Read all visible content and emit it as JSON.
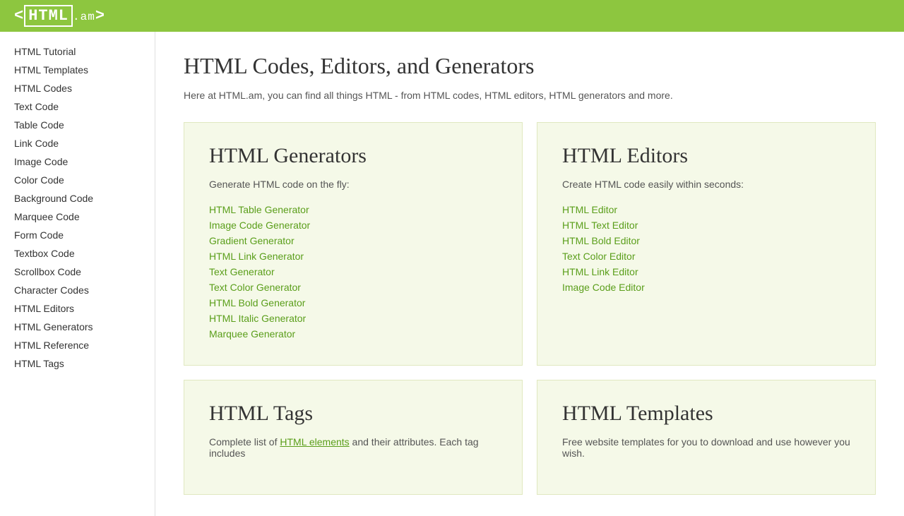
{
  "header": {
    "logo_text": "<HTML.am>"
  },
  "sidebar": {
    "items": [
      {
        "label": "HTML Tutorial",
        "id": "html-tutorial"
      },
      {
        "label": "HTML Templates",
        "id": "html-templates"
      },
      {
        "label": "HTML Codes",
        "id": "html-codes"
      },
      {
        "label": "Text Code",
        "id": "text-code"
      },
      {
        "label": "Table Code",
        "id": "table-code"
      },
      {
        "label": "Link Code",
        "id": "link-code"
      },
      {
        "label": "Image Code",
        "id": "image-code"
      },
      {
        "label": "Color Code",
        "id": "color-code"
      },
      {
        "label": "Background Code",
        "id": "background-code"
      },
      {
        "label": "Marquee Code",
        "id": "marquee-code"
      },
      {
        "label": "Form Code",
        "id": "form-code"
      },
      {
        "label": "Textbox Code",
        "id": "textbox-code"
      },
      {
        "label": "Scrollbox Code",
        "id": "scrollbox-code"
      },
      {
        "label": "Character Codes",
        "id": "character-codes"
      },
      {
        "label": "HTML Editors",
        "id": "html-editors"
      },
      {
        "label": "HTML Generators",
        "id": "html-generators"
      },
      {
        "label": "HTML Reference",
        "id": "html-reference"
      },
      {
        "label": "HTML Tags",
        "id": "html-tags"
      }
    ]
  },
  "main": {
    "page_title": "HTML Codes, Editors, and Generators",
    "page_description": "Here at HTML.am, you can find all things HTML - from HTML codes, HTML editors, HTML generators and more.",
    "sections": [
      {
        "id": "html-generators",
        "title": "HTML Generators",
        "description": "Generate HTML code on the fly:",
        "links": [
          {
            "label": "HTML Table Generator",
            "id": "html-table-generator"
          },
          {
            "label": "Image Code Generator",
            "id": "image-code-generator"
          },
          {
            "label": "Gradient Generator",
            "id": "gradient-generator"
          },
          {
            "label": "HTML Link Generator",
            "id": "html-link-generator"
          },
          {
            "label": "Text Generator",
            "id": "text-generator"
          },
          {
            "label": "Text Color Generator",
            "id": "text-color-generator"
          },
          {
            "label": "HTML Bold Generator",
            "id": "html-bold-generator"
          },
          {
            "label": "HTML Italic Generator",
            "id": "html-italic-generator"
          },
          {
            "label": "Marquee Generator",
            "id": "marquee-generator"
          }
        ]
      },
      {
        "id": "html-editors",
        "title": "HTML Editors",
        "description": "Create HTML code easily within seconds:",
        "links": [
          {
            "label": "HTML Editor",
            "id": "html-editor"
          },
          {
            "label": "HTML Text Editor",
            "id": "html-text-editor"
          },
          {
            "label": "HTML Bold Editor",
            "id": "html-bold-editor"
          },
          {
            "label": "Text Color Editor",
            "id": "text-color-editor"
          },
          {
            "label": "HTML Link Editor",
            "id": "html-link-editor"
          },
          {
            "label": "Image Code Editor",
            "id": "image-code-editor"
          }
        ]
      },
      {
        "id": "html-tags",
        "title": "HTML Tags",
        "description_start": "Complete list of ",
        "description_link": "HTML elements",
        "description_end": " and their attributes. Each tag includes",
        "links": []
      },
      {
        "id": "html-templates",
        "title": "HTML Templates",
        "description": "Free website templates for you to download and use however you wish.",
        "links": []
      }
    ]
  }
}
